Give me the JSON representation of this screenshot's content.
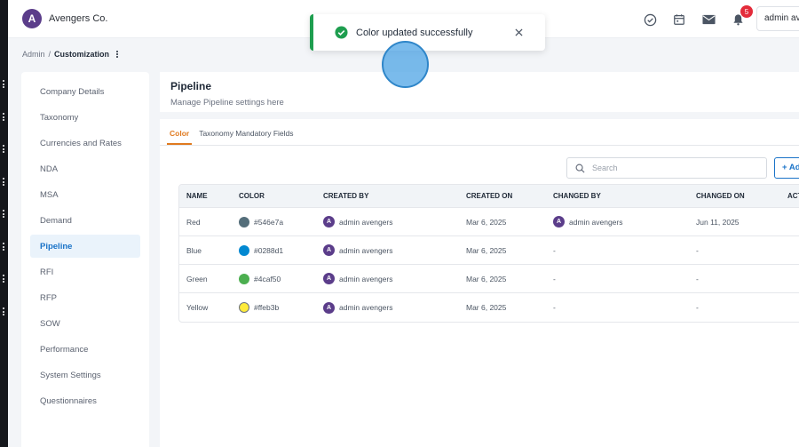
{
  "brand": {
    "name": "Avengers Co.",
    "logo_letter": "A"
  },
  "topbar": {
    "icons": [
      "tasks-check-icon",
      "calendar-icon",
      "mail-icon",
      "bell-icon"
    ],
    "notification_count": "5",
    "user_label": "admin av"
  },
  "breadcrumb": {
    "root": "Admin",
    "separator": "/",
    "current": "Customization"
  },
  "sidebar": {
    "items": [
      {
        "label": "Company Details"
      },
      {
        "label": "Taxonomy"
      },
      {
        "label": "Currencies and Rates"
      },
      {
        "label": "NDA"
      },
      {
        "label": "MSA"
      },
      {
        "label": "Demand"
      },
      {
        "label": "Pipeline",
        "active": true
      },
      {
        "label": "RFI"
      },
      {
        "label": "RFP"
      },
      {
        "label": "SOW"
      },
      {
        "label": "Performance"
      },
      {
        "label": "System Settings"
      },
      {
        "label": "Questionnaires"
      }
    ]
  },
  "page": {
    "title": "Pipeline",
    "subtitle": "Manage Pipeline settings here"
  },
  "tabs": [
    {
      "label": "Color",
      "active": true
    },
    {
      "label": "Taxonomy Mandatory Fields"
    }
  ],
  "search": {
    "placeholder": "Search"
  },
  "add_button": {
    "label": "+ Add"
  },
  "table": {
    "headers": [
      "NAME",
      "COLOR",
      "CREATED BY",
      "CREATED ON",
      "CHANGED BY",
      "CHANGED ON",
      "ACTIO"
    ],
    "rows": [
      {
        "name": "Red",
        "color_hex": "#546e7a",
        "color_label": "#546e7a",
        "created_by": "admin avengers",
        "created_on": "Mar 6, 2025",
        "changed_by": "admin avengers",
        "changed_on": "Jun 11, 2025"
      },
      {
        "name": "Blue",
        "color_hex": "#0288d1",
        "color_label": "#0288d1",
        "created_by": "admin avengers",
        "created_on": "Mar 6, 2025",
        "changed_by": "-",
        "changed_on": "-"
      },
      {
        "name": "Green",
        "color_hex": "#4caf50",
        "color_label": "#4caf50",
        "created_by": "admin avengers",
        "created_on": "Mar 6, 2025",
        "changed_by": "-",
        "changed_on": "-"
      },
      {
        "name": "Yellow",
        "color_hex": "#ffeb3b",
        "color_label": "#ffeb3b",
        "created_by": "admin avengers",
        "created_on": "Mar 6, 2025",
        "changed_by": "-",
        "changed_on": "-"
      }
    ]
  },
  "toast": {
    "message": "Color updated successfully",
    "accent": "#1e9e4f"
  },
  "colors": {
    "primary": "#1a73c8",
    "active_tab": "#e07a1f",
    "brand": "#5b3d8a"
  }
}
